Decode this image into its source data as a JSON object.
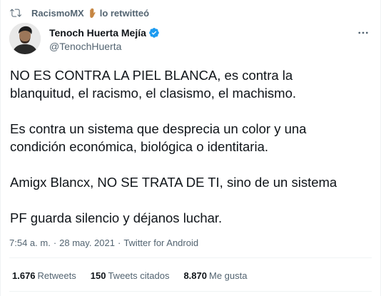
{
  "retweet": {
    "user": "RacismoMX",
    "emoji": "raised-hand",
    "action": "lo retwitteó"
  },
  "author": {
    "display_name": "Tenoch Huerta Mejía",
    "handle": "@TenochHuerta",
    "verified": true
  },
  "tweet": {
    "paragraphs": [
      "NO ES CONTRA LA PIEL BLANCA, es contra la\nblanquitud, el racismo, el clasismo, el machismo.",
      "Es contra un sistema que desprecia un color y una\ncondición económica, biológica o identitaria.",
      "Amigx Blancx, NO SE TRATA DE TI, sino de un sistema",
      "PF guarda silencio y déjanos luchar."
    ]
  },
  "meta": {
    "time": "7:54 a. m.",
    "separator": "·",
    "date": "28 may. 2021",
    "source": "Twitter for Android"
  },
  "stats": {
    "retweets_count": "1.676",
    "retweets_label": "Retweets",
    "quotes_count": "150",
    "quotes_label": "Tweets citados",
    "likes_count": "8.870",
    "likes_label": "Me gusta"
  },
  "colors": {
    "text_primary": "#0f1419",
    "text_secondary": "#536471",
    "verified_blue": "#1d9bf0",
    "divider": "#eff3f4"
  },
  "icons": {
    "retweet": "retweet-icon",
    "verified": "verified-badge-icon",
    "more": "more-options-icon"
  }
}
